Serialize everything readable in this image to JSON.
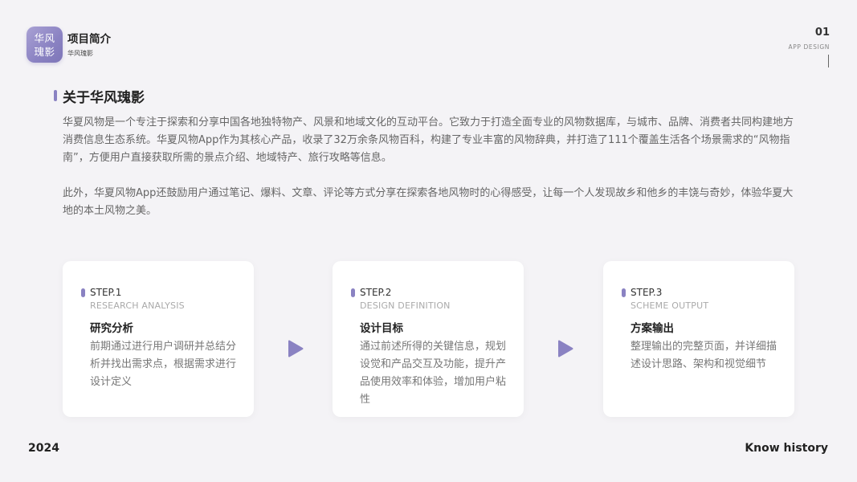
{
  "header": {
    "logo_line1": "华风",
    "logo_line2": "瑰影",
    "title": "项目简介",
    "subtitle": "华风瑰影",
    "page_number": "01",
    "tag": "APP DESIGN"
  },
  "section": {
    "title": "关于华风瑰影",
    "paragraph1": "华夏风物是一个专注于探索和分享中国各地独特物产、风景和地域文化的互动平台。它致力于打造全面专业的风物数据库，与城市、品牌、消费者共同构建地方消费信息生态系统。华夏风物App作为其核心产品，收录了32万余条风物百科，构建了专业丰富的风物辞典，并打造了111个覆盖生活各个场景需求的“风物指南”，方便用户直接获取所需的景点介绍、地域特产、旅行攻略等信息。",
    "paragraph2": "此外，华夏风物App还鼓励用户通过笔记、爆料、文章、评论等方式分享在探索各地风物时的心得感受，让每一个人发现故乡和他乡的丰饶与奇妙，体验华夏大地的本土风物之美。"
  },
  "steps": [
    {
      "step": "STEP.1",
      "en": "RESEARCH ANALYSIS",
      "cn": "研究分析",
      "desc": "前期通过进行用户调研并总结分析并找出需求点，根据需求进行设计定义"
    },
    {
      "step": "STEP.2",
      "en": "DESIGN DEFINITION",
      "cn": "设计目标",
      "desc": "通过前述所得的关键信息，规划设觉和产品交互及功能，提升产品使用效率和体验，增加用户粘性"
    },
    {
      "step": "STEP.3",
      "en": "SCHEME OUTPUT",
      "cn": "方案输出",
      "desc": "整理输出的完整页面，并详细描述设计思路、架构和视觉细节"
    }
  ],
  "footer": {
    "year": "2024",
    "right": "Know history"
  },
  "colors": {
    "accent": "#8a82c2",
    "background": "#f4f3f6"
  }
}
